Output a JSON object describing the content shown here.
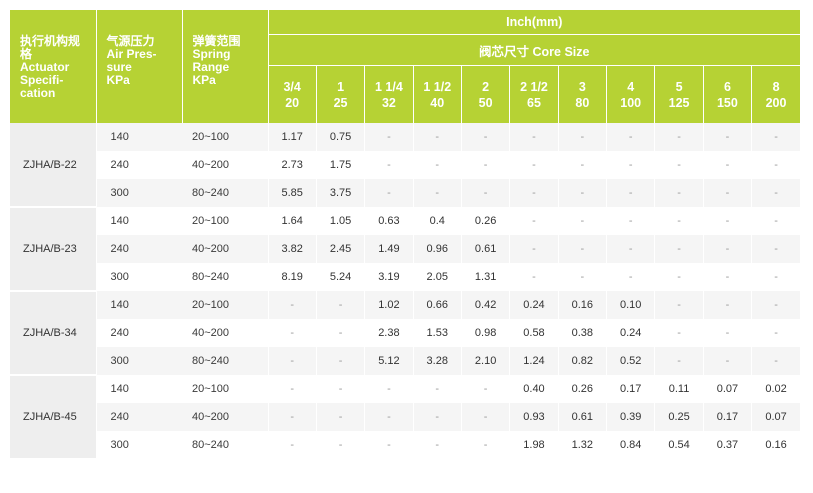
{
  "header": {
    "actuator": {
      "cn": "执行机构规格",
      "en": [
        "Actuator",
        "Specifi-",
        "cation"
      ]
    },
    "air": {
      "cn": "气源压力",
      "en": [
        "Air Pres-",
        "sure",
        "KPa"
      ]
    },
    "spring": {
      "cn": "弹簧范围",
      "en": [
        "Spring",
        "Range",
        "KPa"
      ]
    },
    "inch_label": "Inch(mm)",
    "core_label": "阀芯尺寸 Core Size",
    "sizes": [
      {
        "inch": "3/4",
        "mm": "20"
      },
      {
        "inch": "1",
        "mm": "25"
      },
      {
        "inch": "1 1/4",
        "mm": "32"
      },
      {
        "inch": "1 1/2",
        "mm": "40"
      },
      {
        "inch": "2",
        "mm": "50"
      },
      {
        "inch": "2 1/2",
        "mm": "65"
      },
      {
        "inch": "3",
        "mm": "80"
      },
      {
        "inch": "4",
        "mm": "100"
      },
      {
        "inch": "5",
        "mm": "125"
      },
      {
        "inch": "6",
        "mm": "150"
      },
      {
        "inch": "8",
        "mm": "200"
      }
    ]
  },
  "groups": [
    {
      "model": "ZJHA/B-22",
      "rows": [
        {
          "air": "140",
          "spring": "20~100",
          "values": [
            "1.17",
            "0.75",
            "-",
            "-",
            "-",
            "-",
            "-",
            "-",
            "-",
            "-",
            "-"
          ]
        },
        {
          "air": "240",
          "spring": "40~200",
          "values": [
            "2.73",
            "1.75",
            "-",
            "-",
            "-",
            "-",
            "-",
            "-",
            "-",
            "-",
            "-"
          ]
        },
        {
          "air": "300",
          "spring": "80~240",
          "values": [
            "5.85",
            "3.75",
            "-",
            "-",
            "-",
            "-",
            "-",
            "-",
            "-",
            "-",
            "-"
          ]
        }
      ]
    },
    {
      "model": "ZJHA/B-23",
      "rows": [
        {
          "air": "140",
          "spring": "20~100",
          "values": [
            "1.64",
            "1.05",
            "0.63",
            "0.4",
            "0.26",
            "-",
            "-",
            "-",
            "-",
            "-",
            "-"
          ]
        },
        {
          "air": "240",
          "spring": "40~200",
          "values": [
            "3.82",
            "2.45",
            "1.49",
            "0.96",
            "0.61",
            "-",
            "-",
            "-",
            "-",
            "-",
            "-"
          ]
        },
        {
          "air": "300",
          "spring": "80~240",
          "values": [
            "8.19",
            "5.24",
            "3.19",
            "2.05",
            "1.31",
            "-",
            "-",
            "-",
            "-",
            "-",
            "-"
          ]
        }
      ]
    },
    {
      "model": "ZJHA/B-34",
      "rows": [
        {
          "air": "140",
          "spring": "20~100",
          "values": [
            "-",
            "-",
            "1.02",
            "0.66",
            "0.42",
            "0.24",
            "0.16",
            "0.10",
            "-",
            "-",
            "-"
          ]
        },
        {
          "air": "240",
          "spring": "40~200",
          "values": [
            "-",
            "-",
            "2.38",
            "1.53",
            "0.98",
            "0.58",
            "0.38",
            "0.24",
            "-",
            "-",
            "-"
          ]
        },
        {
          "air": "300",
          "spring": "80~240",
          "values": [
            "-",
            "-",
            "5.12",
            "3.28",
            "2.10",
            "1.24",
            "0.82",
            "0.52",
            "-",
            "-",
            "-"
          ]
        }
      ]
    },
    {
      "model": "ZJHA/B-45",
      "rows": [
        {
          "air": "140",
          "spring": "20~100",
          "values": [
            "-",
            "-",
            "-",
            "-",
            "-",
            "0.40",
            "0.26",
            "0.17",
            "0.11",
            "0.07",
            "0.02"
          ]
        },
        {
          "air": "240",
          "spring": "40~200",
          "values": [
            "-",
            "-",
            "-",
            "-",
            "-",
            "0.93",
            "0.61",
            "0.39",
            "0.25",
            "0.17",
            "0.07"
          ]
        },
        {
          "air": "300",
          "spring": "80~240",
          "values": [
            "-",
            "-",
            "-",
            "-",
            "-",
            "1.98",
            "1.32",
            "0.84",
            "0.54",
            "0.37",
            "0.16"
          ]
        }
      ]
    }
  ],
  "colors": {
    "header_bg": "#b6d234",
    "header_text": "#ffffff",
    "stripe": "#f5f5f5",
    "model_bg": "#eeeeee"
  }
}
